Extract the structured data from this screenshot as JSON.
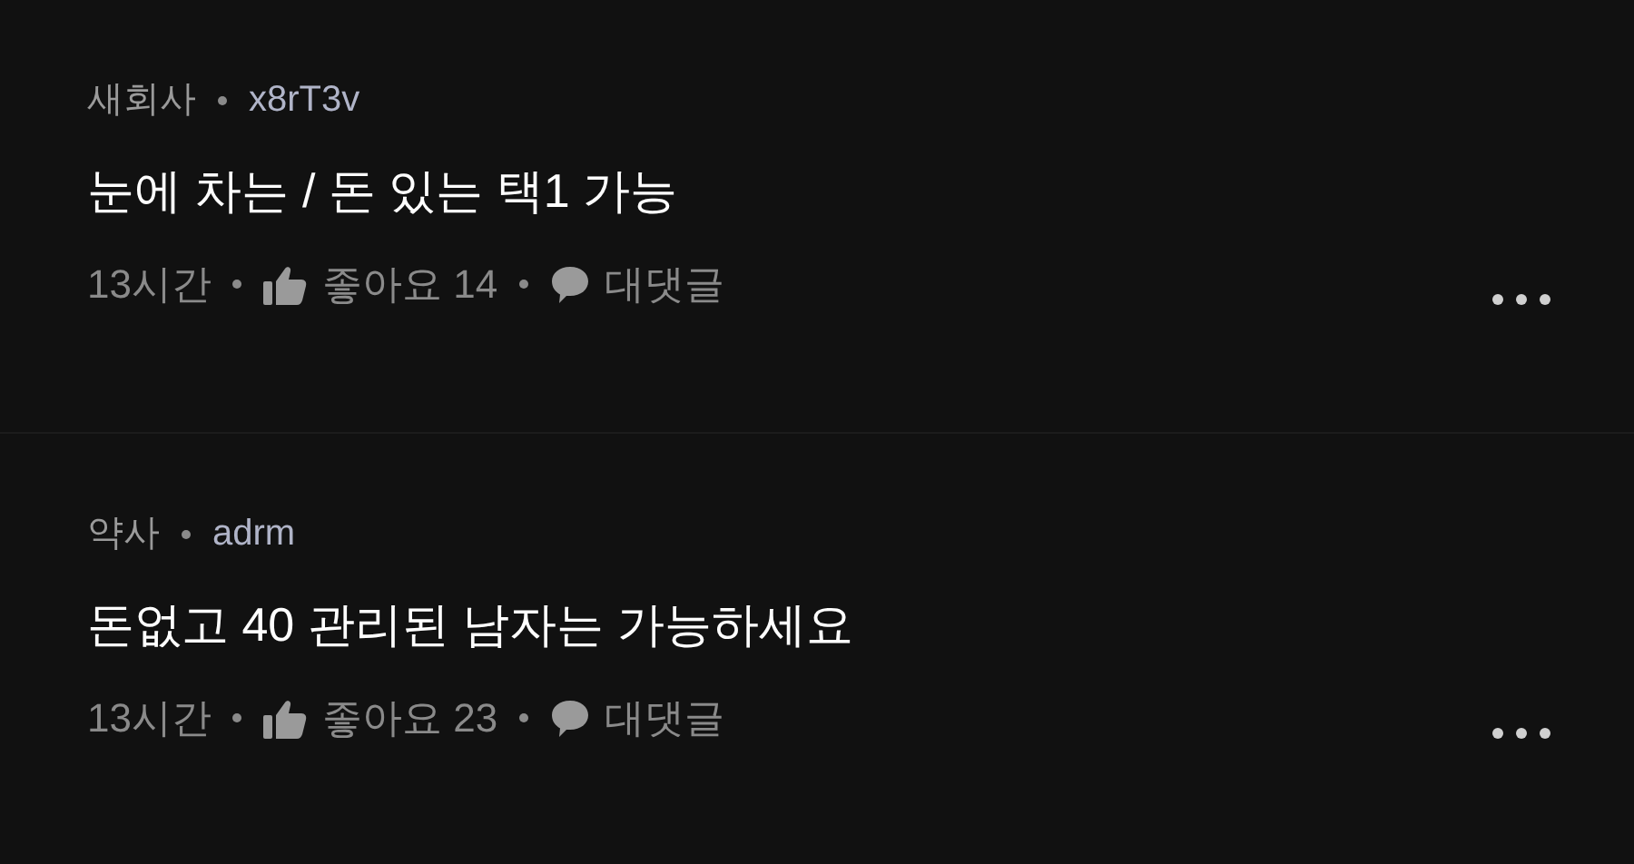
{
  "comments": [
    {
      "company": "새회사",
      "nickname": "x8rT3v",
      "body": "눈에 차는 / 돈 있는 택1 가능",
      "time": "13시간",
      "like_label": "좋아요",
      "likes": "14",
      "reply_label": "대댓글"
    },
    {
      "company": "약사",
      "nickname": "adrm",
      "body": "돈없고 40 관리된 남자는 가능하세요",
      "time": "13시간",
      "like_label": "좋아요",
      "likes": "23",
      "reply_label": "대댓글"
    }
  ]
}
